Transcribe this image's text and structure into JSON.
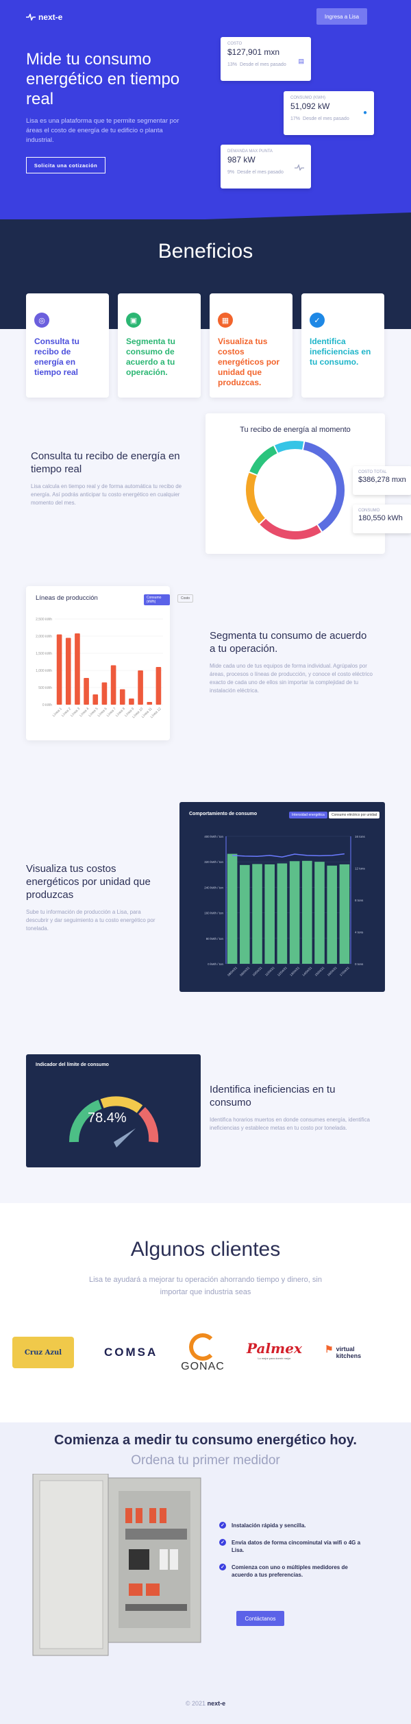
{
  "nav": {
    "brand": "next-e",
    "login_label": "Ingresa a Lisa"
  },
  "hero": {
    "title": "Mide tu consumo energético en tiempo real",
    "text": "Lisa es una plataforma que te permite segmentar por áreas el costo de energía de tu edificio o planta industrial.",
    "cta_label": "Solicita una cotización",
    "cards": [
      {
        "label": "Costo",
        "value": "$127,901 mxn",
        "pct": "13%",
        "note": "Desde el mes pasado",
        "icon": "money-icon"
      },
      {
        "label": "Consumo (KWh)",
        "value": "51,092 kW",
        "pct": "17%",
        "note": "Desde el mes pasado",
        "icon": "location-pin-icon"
      },
      {
        "label": "Demanda max punta",
        "value": "987 kW",
        "pct": "9%",
        "note": "Desde el mes pasado",
        "icon": "pulse-icon"
      }
    ]
  },
  "benefits": {
    "title": "Beneficios",
    "cards": [
      {
        "text": "Consulta tu recibo de energía en tiempo real",
        "color": "#4b4fdc",
        "icon_color": "#6b5fdd",
        "icon": "receipt-icon"
      },
      {
        "text": "Segmenta tu consumo de acuerdo a tu operación.",
        "color": "#2bb673",
        "icon_color": "#2bb673",
        "icon": "briefcase-icon"
      },
      {
        "text": "Visualiza tus costos energéticos por unidad que produzcas.",
        "color": "#f2642c",
        "icon_color": "#f2642c",
        "icon": "chart-icon"
      },
      {
        "text": "Identifica ineficiencias en tu consumo.",
        "color": "#1fb5c9",
        "icon_color": "#1e88e5",
        "icon": "check-icon"
      }
    ]
  },
  "section1": {
    "title": "Consulta tu recibo de energía en tiempo real",
    "text": "Lisa calcula en tiempo real y de forma automática tu recibo de energía. Así podrás anticipar tu costo energético en cualquier momento del mes.",
    "chart_title": "Tu recibo de energía al momento",
    "total_label": "Costo total",
    "total_value": "$386,278 mxn",
    "consumo_label": "Consumo",
    "consumo_value": "180,550 kWh"
  },
  "section2": {
    "title": "Segmenta tu consumo de acuerdo a tu operación.",
    "text": "Mide cada uno de tus equipos de forma individual. Agrúpalos por áreas, procesos o líneas de producción, y conoce el costo eléctrico exacto de cada uno de ellos sin importar la complejidad de tu instalación eléctrica.",
    "chart_title": "Líneas de producción",
    "tab1": "Consumo (kWh)",
    "tab2": "Costo"
  },
  "section3": {
    "title": "Visualiza tus costos energéticos por unidad que produzcas",
    "text": "Sube tu información de producción a Lisa, para descubrir y dar seguimiento a tu costo energético por tonelada.",
    "chart_title": "Comportamiento de consumo",
    "tab1": "Intensidad energética",
    "tab2": "Consumo eléctrico por unidad"
  },
  "section4": {
    "title": "Identifica ineficiencias en tu consumo",
    "text": "Identifica horarios muertos en donde consumes energía, identifica ineficiencias y establece metas en tu costo por tonelada.",
    "chart_title": "Indicador del límite de consumo",
    "gauge_value": "78.4%"
  },
  "clients": {
    "title": "Algunos clientes",
    "subtitle": "Lisa te ayudará a mejorar tu operación ahorrando tiempo y dinero, sin importar que industria seas",
    "logos": [
      "Cruz Azul",
      "COMSA",
      "GONAC",
      "Palmex",
      "virtual kitchens"
    ],
    "palmex_tagline": "Lo mejor para dormir mejor"
  },
  "cta": {
    "title": "Comienza a medir tu consumo energético hoy.",
    "subtitle": "Ordena tu primer medidor",
    "bullets": [
      "Instalación rápida y sencilla.",
      "Envía datos de forma cincominutal vía wifi o 4G a Lisa.",
      "Comienza con uno o múltiples medidores de acuerdo a tus preferencias."
    ],
    "button_label": "Contáctanos"
  },
  "footer": {
    "year": "© 2021",
    "brand": "next-e"
  },
  "chart_data": [
    {
      "type": "pie",
      "title": "Tu recibo de energía al momento",
      "series": [
        {
          "color": "#5b6ee1",
          "values": [
            38
          ]
        },
        {
          "color": "#e84c6a",
          "values": [
            22
          ]
        },
        {
          "color": "#f5a524",
          "values": [
            18
          ]
        },
        {
          "color": "#2bc47d",
          "values": [
            12
          ]
        },
        {
          "color": "#35c4e6",
          "values": [
            10
          ]
        }
      ]
    },
    {
      "type": "bar",
      "title": "Líneas de producción",
      "categories": [
        "Línea 1",
        "Línea 2",
        "Línea 3",
        "Línea 4",
        "Línea 5",
        "Línea 6",
        "Línea 7",
        "Línea 8",
        "Línea 9",
        "Línea 10",
        "Línea 11",
        "Línea 12"
      ],
      "values": [
        2050,
        1950,
        2080,
        780,
        300,
        650,
        1150,
        450,
        180,
        1000,
        80,
        1100
      ],
      "ylim": [
        0,
        2500
      ],
      "yticks": [
        "0 kWh",
        "500 kWh",
        "1,000 kWh",
        "1,500 kWh",
        "2,000 kWh",
        "2,500 kWh"
      ]
    },
    {
      "type": "bar",
      "title": "Comportamiento de consumo",
      "categories": [
        "08/04/21",
        "09/04/21",
        "10/04/21",
        "11/04/21",
        "12/04/21",
        "13/04/21",
        "14/04/21",
        "15/04/21",
        "16/04/21",
        "17/04/21"
      ],
      "values": [
        345,
        310,
        313,
        312,
        315,
        322,
        323,
        320,
        308,
        312
      ],
      "line_values": [
        340,
        338,
        337,
        340,
        335,
        344,
        340,
        339,
        340,
        345
      ],
      "ylim": [
        0,
        400
      ],
      "yticks": [
        "0 kWh / ton",
        "80 kWh / ton",
        "160 kWh / ton",
        "240 kWh / ton",
        "320 kWh / ton",
        "400 kWh / ton"
      ],
      "y2ticks": [
        "0 tons",
        "4 tons",
        "8 tons",
        "12 tons",
        "16 tons"
      ]
    }
  ]
}
